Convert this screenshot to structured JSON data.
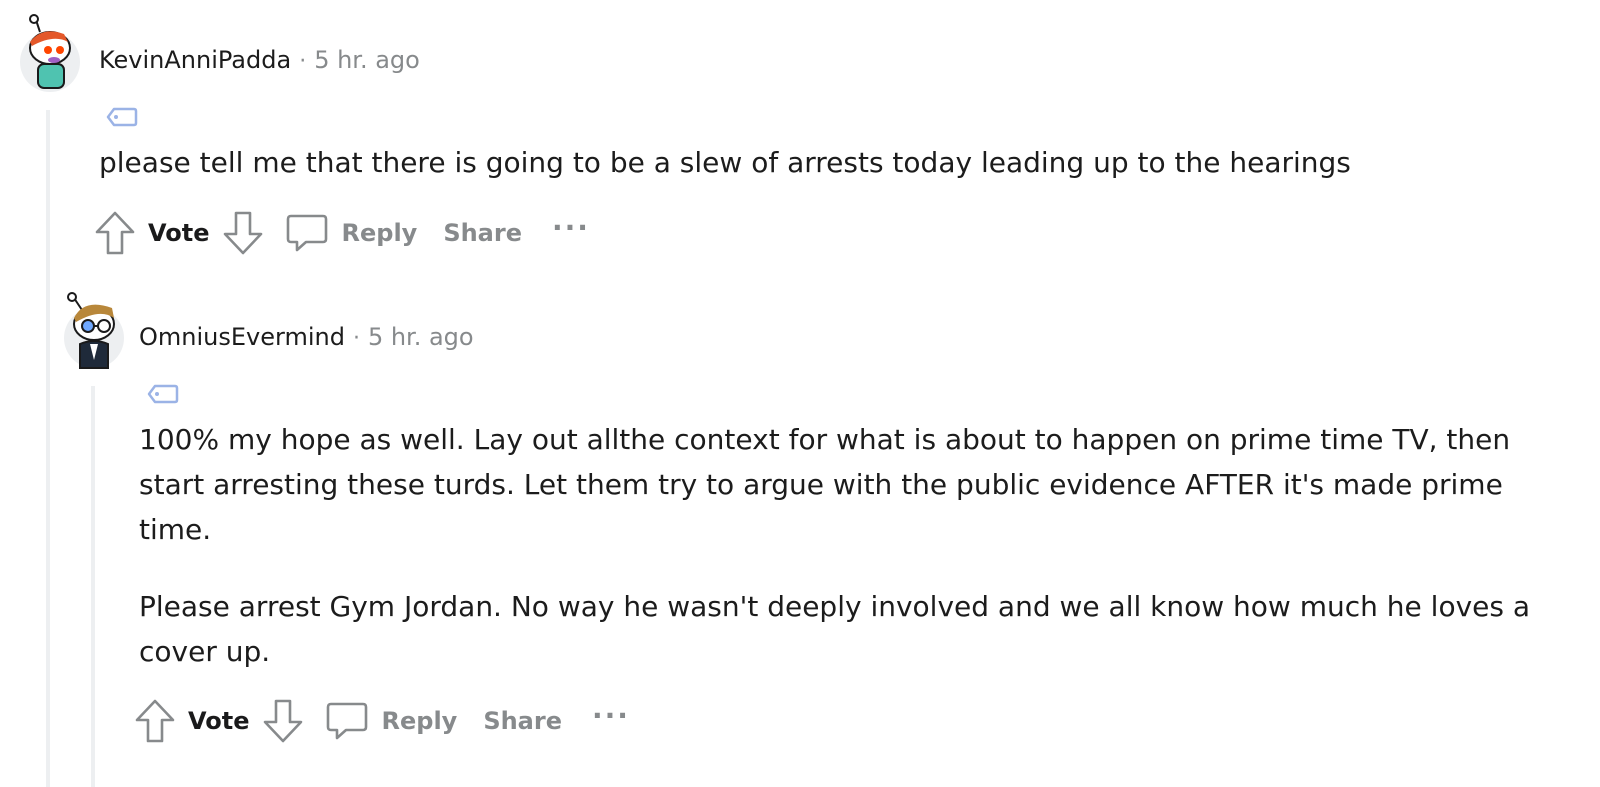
{
  "comments": [
    {
      "author": "KevinAnniPadda",
      "separator": "·",
      "time": "5 hr. ago",
      "paragraphs": [
        "please tell me that there is going to be a slew of arrests today leading up to the hearings"
      ],
      "actions": {
        "vote": "Vote",
        "reply": "Reply",
        "share": "Share",
        "more": "···"
      },
      "avatar_icon": "snoo-avatar-icon"
    },
    {
      "author": "OmniusEvermind",
      "separator": "·",
      "time": "5 hr. ago",
      "paragraphs": [
        "100% my hope as well. Lay out allthe context for what is about to happen on prime time TV, then start arresting these turds. Let them try to argue with the public evidence AFTER it's made prime time.",
        "Please arrest Gym Jordan. No way he wasn't deeply involved and we all know how much he loves a cover up."
      ],
      "actions": {
        "vote": "Vote",
        "reply": "Reply",
        "share": "Share",
        "more": "···"
      },
      "avatar_icon": "snoo-avatar-icon"
    }
  ],
  "colors": {
    "meta_gray": "#878a8c",
    "thread_line": "#edeff1",
    "flair_blue": "#7193ff",
    "text": "#1c1c1c"
  }
}
